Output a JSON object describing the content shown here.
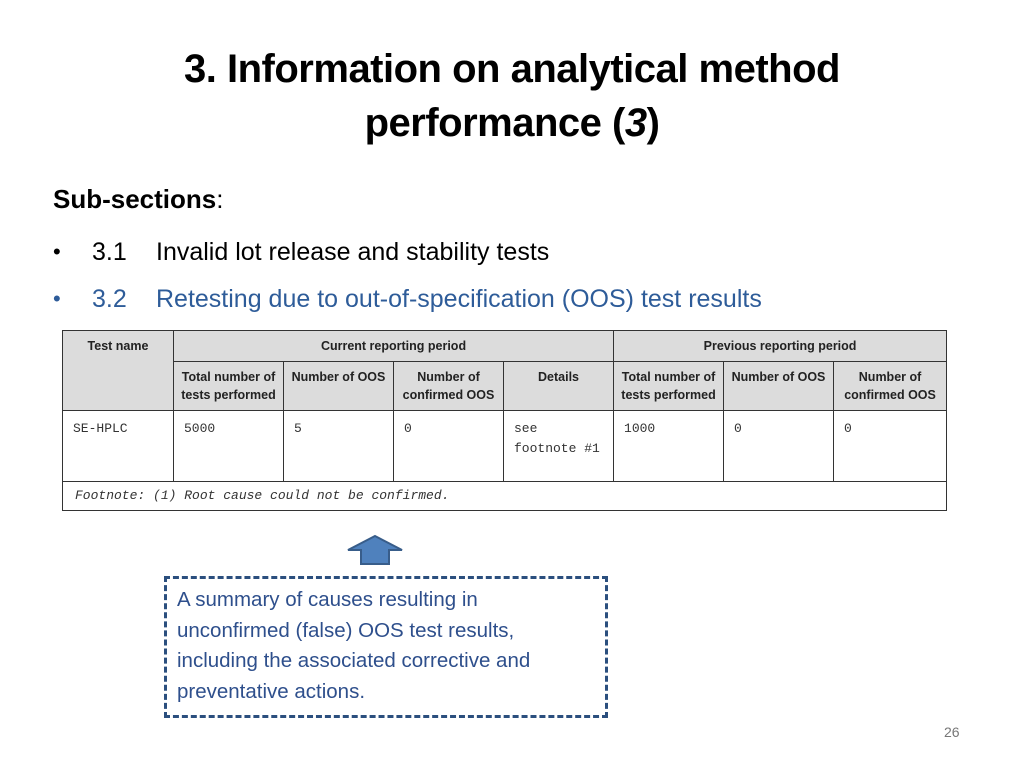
{
  "slide": {
    "title_line1": "3. Information on analytical method",
    "title_line2_prefix": "performance (",
    "title_line2_italic": "3",
    "title_line2_suffix": ")",
    "subsections_label": "Sub-sections",
    "subsections_colon": ":",
    "subsections": [
      {
        "bullet": "•",
        "number": "3.1",
        "label": "Invalid lot release and stability tests",
        "active": false
      },
      {
        "bullet": "•",
        "number": "3.2",
        "label": "Retesting due to out-of-specification (OOS) test results",
        "active": true
      }
    ],
    "page_number": "26"
  },
  "table": {
    "test_name_header": "Test name",
    "current_period_header": "Current reporting period",
    "previous_period_header": "Previous reporting period",
    "current_columns": [
      "Total number of tests performed",
      "Number of OOS",
      "Number of confirmed OOS",
      "Details"
    ],
    "previous_columns": [
      "Total number of tests performed",
      "Number of OOS",
      "Number of confirmed OOS"
    ],
    "rows": [
      {
        "test_name": "SE-HPLC",
        "current": [
          "5000",
          "5",
          "0",
          "see footnote #1"
        ],
        "previous": [
          "1000",
          "0",
          "0"
        ]
      }
    ],
    "footnote": "Footnote: (1) Root cause could not be confirmed."
  },
  "callout": {
    "text": "A summary of causes resulting in unconfirmed (false) OOS test results, including the associated corrective and preventative actions.",
    "arrow_icon": "up-arrow-icon"
  },
  "colors": {
    "accent_blue": "#2e5c99",
    "arrow_fill": "#4f81bd",
    "arrow_stroke": "#385d8a",
    "callout_border": "#2b4f7e",
    "header_bg": "#dcdcdc"
  }
}
